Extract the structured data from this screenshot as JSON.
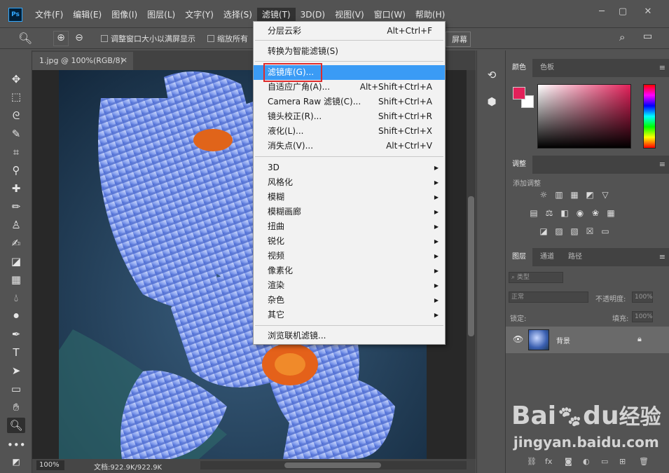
{
  "app": {
    "logo": "Ps",
    "menus": [
      "文件(F)",
      "编辑(E)",
      "图像(I)",
      "图层(L)",
      "文字(Y)",
      "选择(S)",
      "滤镜(T)",
      "3D(D)",
      "视图(V)",
      "窗口(W)",
      "帮助(H)"
    ],
    "active_menu": "滤镜(T)",
    "window_controls": [
      "─",
      "▢",
      "✕"
    ]
  },
  "options_bar": {
    "checkbox_1": "调整窗口大小以满屏显示",
    "checkbox_2": "缩放所有",
    "fill_screen": "屏幕"
  },
  "document": {
    "tab_title": "1.jpg @ 100%(RGB/8)",
    "tab_close": "×",
    "zoom": "100%",
    "doc_info": "文档:922.9K/922.9K"
  },
  "filter_menu": {
    "items": [
      {
        "label": "分层云彩",
        "shortcut": "Alt+Ctrl+F"
      },
      {
        "label": "转换为智能滤镜(S)",
        "shortcut": ""
      },
      {
        "label": "滤镜库(G)...",
        "shortcut": "",
        "highlighted": true
      },
      {
        "label": "自适应广角(A)...",
        "shortcut": "Alt+Shift+Ctrl+A"
      },
      {
        "label": "Camera Raw 滤镜(C)...",
        "shortcut": "Shift+Ctrl+A"
      },
      {
        "label": "镜头校正(R)...",
        "shortcut": "Shift+Ctrl+R"
      },
      {
        "label": "液化(L)...",
        "shortcut": "Shift+Ctrl+X"
      },
      {
        "label": "消失点(V)...",
        "shortcut": "Alt+Ctrl+V"
      },
      {
        "label": "3D",
        "submenu": true
      },
      {
        "label": "风格化",
        "submenu": true
      },
      {
        "label": "模糊",
        "submenu": true
      },
      {
        "label": "模糊画廊",
        "submenu": true
      },
      {
        "label": "扭曲",
        "submenu": true
      },
      {
        "label": "锐化",
        "submenu": true
      },
      {
        "label": "视频",
        "submenu": true
      },
      {
        "label": "像素化",
        "submenu": true
      },
      {
        "label": "渲染",
        "submenu": true
      },
      {
        "label": "杂色",
        "submenu": true
      },
      {
        "label": "其它",
        "submenu": true
      },
      {
        "label": "浏览联机滤镜...",
        "shortcut": ""
      }
    ]
  },
  "panels": {
    "color_tabs": [
      "颜色",
      "色板"
    ],
    "adjust_tab": "调整",
    "adjust_add": "添加调整",
    "layer_tabs": [
      "图层",
      "通道",
      "路径"
    ],
    "kind_filter": "类型",
    "blend_mode": "正常",
    "opacity_label": "不透明度:",
    "opacity_value": "100%",
    "lock_label": "锁定:",
    "fill_label": "填充:",
    "fill_value": "100%",
    "layer_name": "背景",
    "foreground_color": "#e3215a"
  },
  "watermark": {
    "brand": "Bai",
    "brand2": "du",
    "brand_cn": "经验",
    "url": "jingyan.baidu.com"
  }
}
